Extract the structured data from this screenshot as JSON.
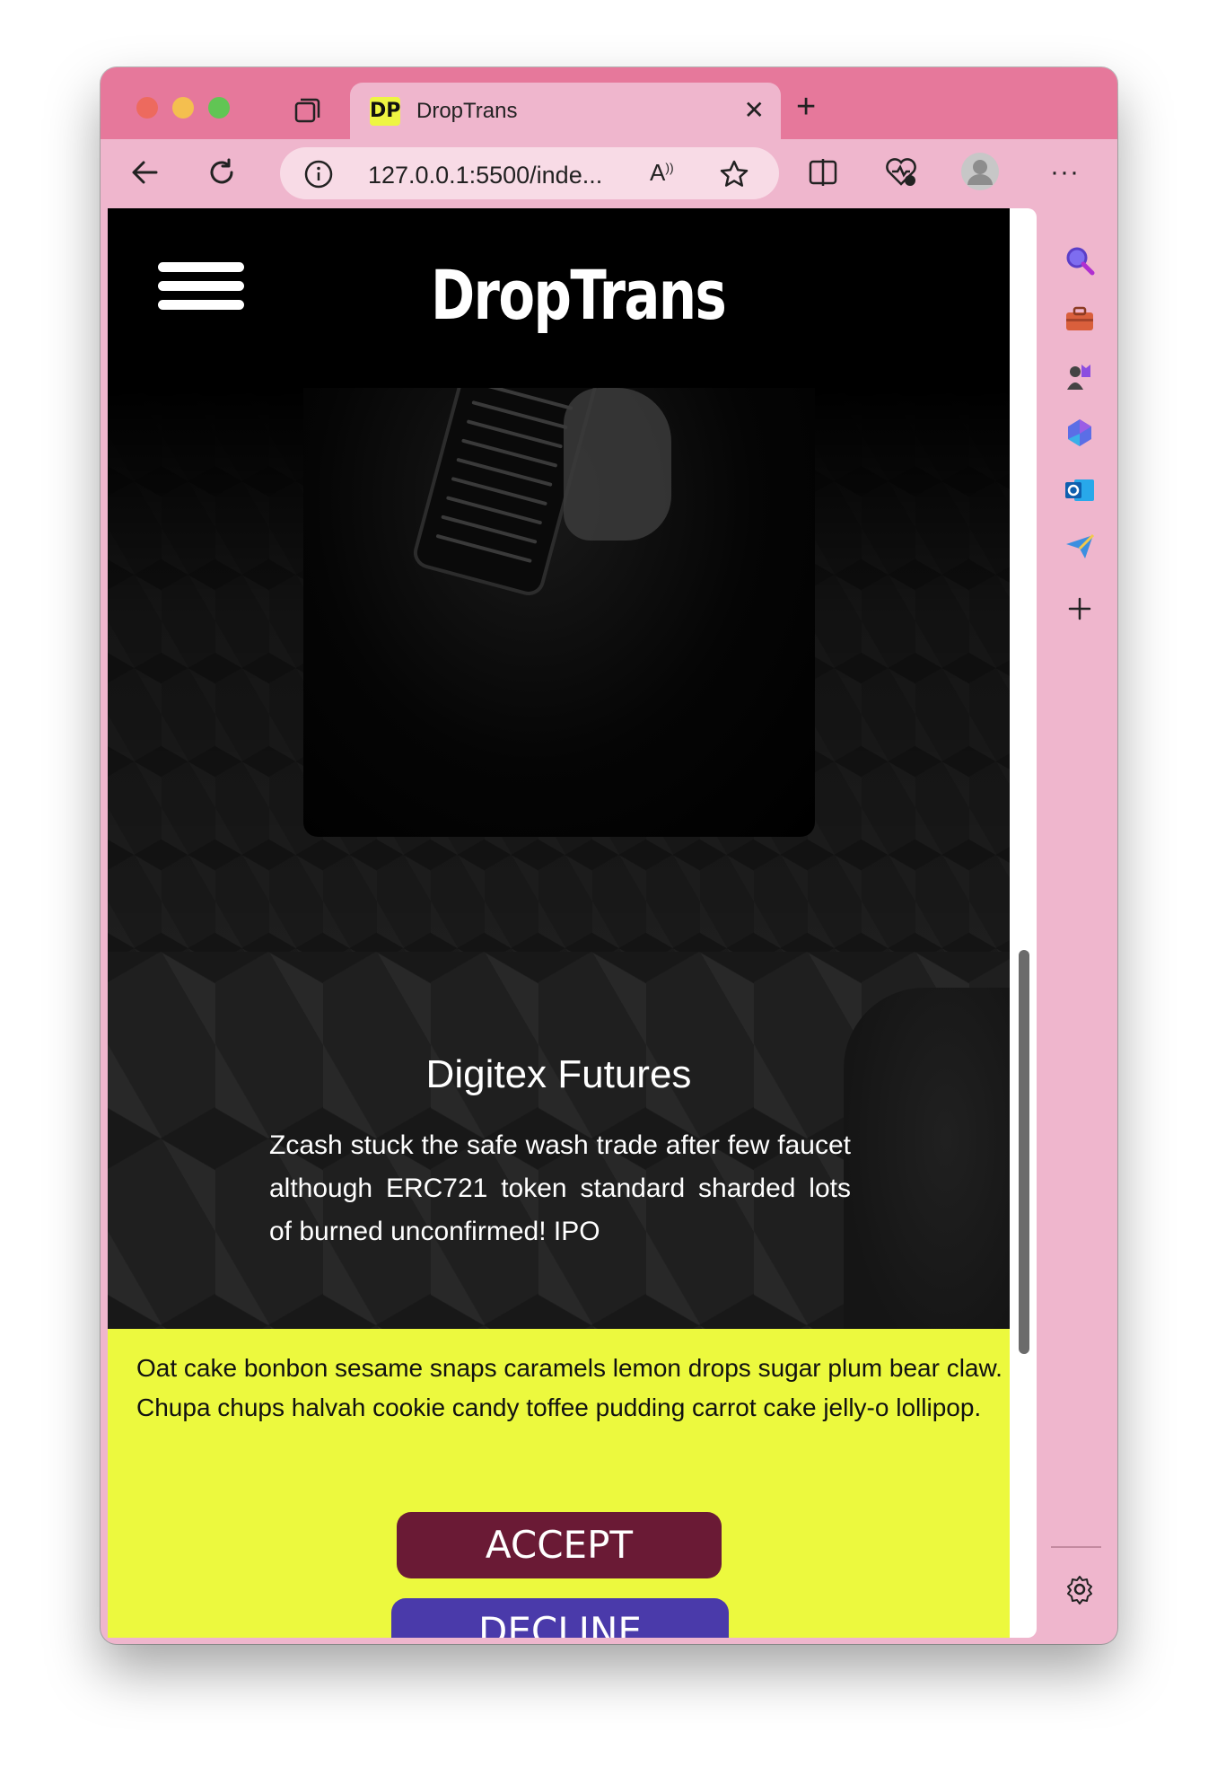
{
  "browser": {
    "tab_favicon": "DP",
    "tab_title": "DropTrans",
    "address": "127.0.0.1:5500/inde...",
    "icons": [
      "tab-actions-icon",
      "close-icon",
      "new-tab-icon",
      "back-icon",
      "refresh-icon",
      "info-icon",
      "read-aloud-icon",
      "favorite-star-icon",
      "split-screen-icon",
      "browser-essentials-icon",
      "profile-avatar-icon",
      "more-icon"
    ]
  },
  "sidebar": {
    "icons": [
      "search-icon",
      "tools-briefcase-icon",
      "games-icon",
      "copilot-icon",
      "outlook-icon",
      "send-icon",
      "add-icon",
      "settings-gear-icon"
    ]
  },
  "site": {
    "logo": "DropTrans",
    "card_title": "Digitex Futures",
    "card_text": "Zcash stuck the safe wash trade after few faucet although ERC721 token standard sharded lots of burned unconfirmed! IPO"
  },
  "cookie_banner": {
    "text": "Oat cake bonbon sesame snaps caramels lemon drops sugar plum bear claw. Chupa chups halvah cookie candy toffee pudding carrot cake jelly-o lollipop.",
    "accept_label": "ACCEPT",
    "decline_label": "DECLINE"
  },
  "colors": {
    "titlebar": "#e6789b",
    "chrome": "#efb6cd",
    "cookie_bg": "#ecf93e",
    "accept_bg": "#6a1a35",
    "decline_bg": "#4a3aaa"
  }
}
